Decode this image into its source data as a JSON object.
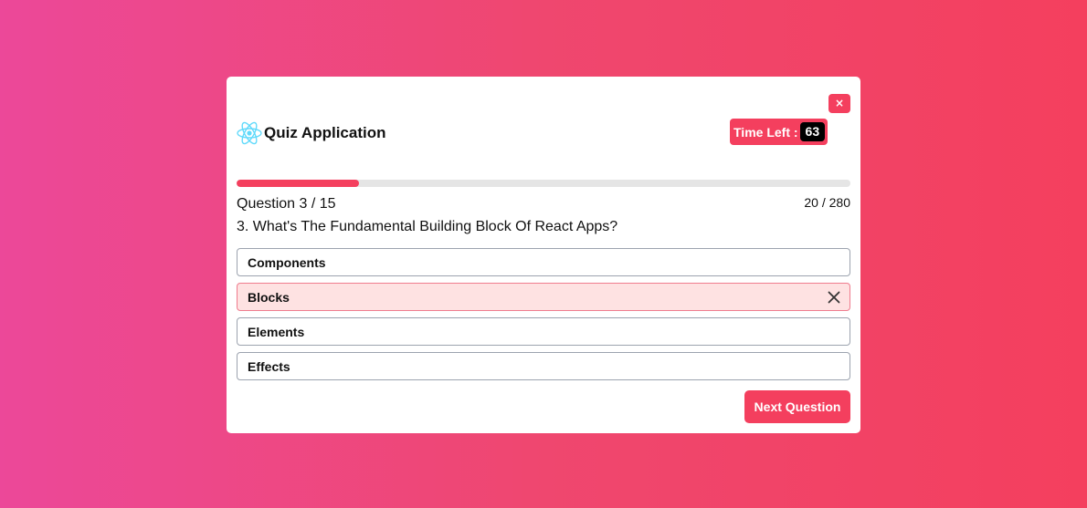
{
  "app": {
    "title": "Quiz Application",
    "logo_icon": "react-atom-icon",
    "close_label": "×"
  },
  "timer": {
    "label": "Time Left :",
    "value": "63"
  },
  "progress": {
    "fraction": 0.2
  },
  "quiz": {
    "counter": "Question 3 / 15",
    "score": "20 / 280",
    "question": "3. What's The Fundamental Building Block Of React Apps?",
    "options": [
      {
        "label": "Components",
        "state": "default"
      },
      {
        "label": "Blocks",
        "state": "wrong",
        "icon": "close-icon"
      },
      {
        "label": "Elements",
        "state": "default"
      },
      {
        "label": "Effects",
        "state": "default"
      }
    ],
    "next_label": "Next Question"
  },
  "colors": {
    "accent": "#f43f5e",
    "wrong_bg": "#fee2e2",
    "react_cyan": "#61dafb"
  }
}
